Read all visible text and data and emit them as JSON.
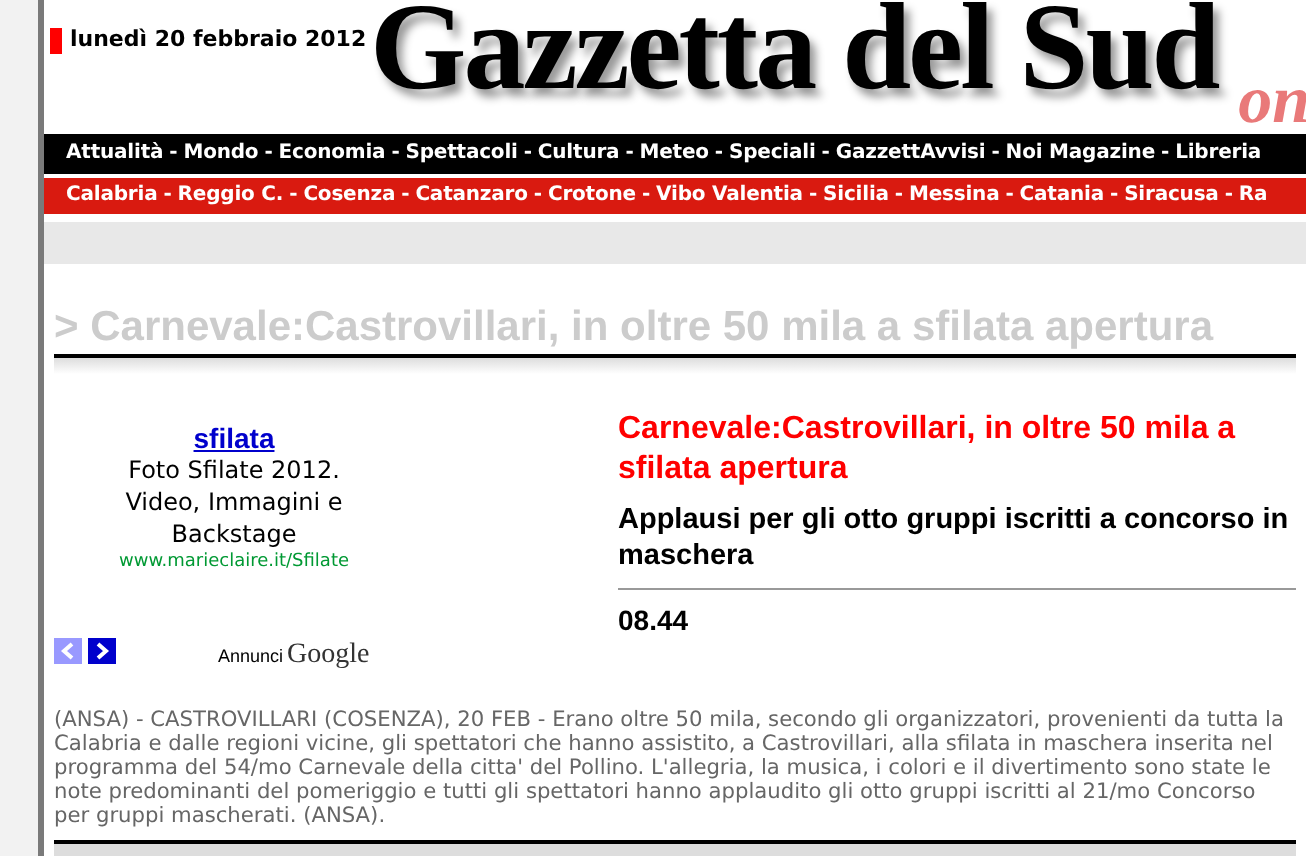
{
  "date": "lunedì 20 febbraio 2012",
  "logo": {
    "title": "Gazzetta del Sud",
    "suffix": "on"
  },
  "menus": [
    {
      "kind": "main",
      "separator": "-",
      "items": [
        "Attualità",
        "Mondo",
        "Economia",
        "Spettacoli",
        "Cultura",
        "Meteo",
        "Speciali",
        "GazzettAvvisi",
        "Noi Magazine",
        "Libreria"
      ]
    },
    {
      "kind": "regional",
      "separator": "-",
      "items": [
        "Calabria",
        "Reggio C.",
        "Cosenza",
        "Catanzaro",
        "Crotone",
        "Vibo Valentia",
        "Sicilia",
        "Messina",
        "Catania",
        "Siracusa",
        "Ra"
      ]
    }
  ],
  "page_title": "> Carnevale:Castrovillari, in oltre 50 mila a sfilata apertura",
  "ad": {
    "link": "sfilata",
    "text": "Foto Sfilate 2012. Video, Immagini e Backstage",
    "url": "www.marieclaire.it/Sfilate",
    "nav": [
      {
        "kind": "prev",
        "disabled": true
      },
      {
        "kind": "next",
        "disabled": false
      }
    ],
    "label": "Annunci",
    "brand": "Google"
  },
  "article": {
    "headline": "Carnevale:Castrovillari, in oltre 50 mila a sfilata apertura",
    "subhead": "Applausi per gli otto gruppi iscritti a concorso in maschera",
    "time": "08.44",
    "body": "(ANSA) - CASTROVILLARI (COSENZA), 20 FEB - Erano oltre 50 mila, secondo gli organizzatori, provenienti da tutta la Calabria e dalle regioni vicine, gli spettatori che hanno assistito, a Castrovillari, alla sfilata in maschera inserita nel programma del 54/mo Carnevale della citta' del Pollino. L'allegria, la musica, i colori e il divertimento sono state le note predominanti del pomeriggio e tutti gli spettatori hanno applaudito gli otto gruppi iscritti al 21/mo Concorso per gruppi mascherati. (ANSA)."
  }
}
